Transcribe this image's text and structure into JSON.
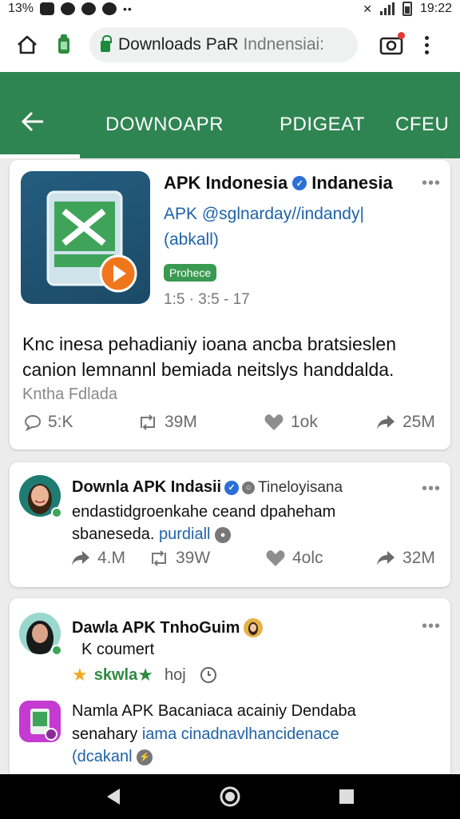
{
  "status": {
    "battery_pct": "13%",
    "time": "19:22",
    "more": "••"
  },
  "browser": {
    "url": "Downloads PaR",
    "url_suffix": "Indnensiai:"
  },
  "appbar": {
    "tabs": [
      "DOWNOAPR",
      "PDIGEAT",
      "CFEU"
    ]
  },
  "featured": {
    "title": "APK Indonesia",
    "title_suffix": "Indanesia",
    "handle": "APK @sglnarday//indandy|",
    "handle_line2": "(abkall)",
    "badge": "Prohece",
    "time": "1:5 · 3:5 - 17",
    "body": "Knc inesa pehadianiy ioana ancba bratsieslen canion lemnannl bemiada neitslys handdalda.",
    "source": "Kntha Fdlada",
    "stats": {
      "comments": "5:K",
      "retweets": "39M",
      "likes": "1ok",
      "shares": "25M"
    }
  },
  "post1": {
    "name": "Downla APK Indasii",
    "meta": "Tineloyisana",
    "text": "endastidgroenkahe ceand dpaheham sbaneseda.",
    "link": "purdiall",
    "stats": {
      "shares_left": "4.M",
      "retweets": "39W",
      "likes": "4olc",
      "shares": "32M"
    }
  },
  "post2": {
    "name": "Dawla APK TnhoGuim",
    "sub": "K coumert",
    "rating_label": "skwla",
    "extra": "hoj"
  },
  "post3": {
    "name": "Namla APK Bacaniaca acainiy Dendaba",
    "text_prefix": "senahary",
    "link": "iama cinadnavlhancidenace",
    "link_line2": "(dcakanl"
  },
  "colors": {
    "brand_green": "#2f8552",
    "link_blue": "#1e62a8",
    "star": "#f2a81d"
  }
}
